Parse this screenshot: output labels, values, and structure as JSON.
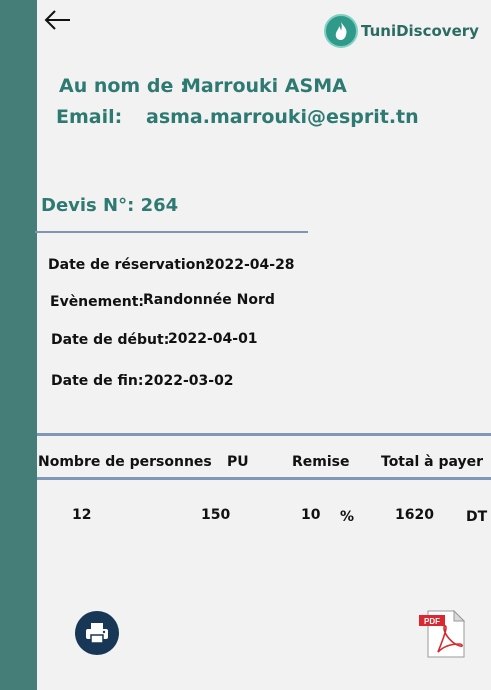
{
  "brand": {
    "name": "TuniDiscovery"
  },
  "client": {
    "name_label": "Au nom de :",
    "name": "Marrouki ASMA",
    "email_label": "Email:",
    "email": "asma.marrouki@esprit.tn"
  },
  "devis": {
    "label": "Devis N°:",
    "number": "264"
  },
  "details": {
    "reservation_label": "Date de réservation:",
    "reservation_date": "2022-04-28",
    "event_label": "Evènement:",
    "event": "Randonnée Nord",
    "start_label": "Date de début:",
    "start_date": "2022-04-01",
    "end_label": "Date de fin:",
    "end_date": "2022-03-02"
  },
  "table": {
    "headers": [
      "Nombre de personnes",
      "PU",
      "Remise",
      "Total à payer"
    ],
    "row": {
      "persons": "12",
      "unit_price": "150",
      "discount": "10",
      "discount_unit": "%",
      "total": "1620",
      "currency": "DT"
    }
  },
  "icons": {
    "back": "arrow-left-icon",
    "logo": "flame-logo-icon",
    "print": "printer-icon",
    "pdf": "pdf-file-icon"
  },
  "colors": {
    "sidebar": "#457e79",
    "accent": "#2e7a72",
    "divider": "#8197b8",
    "print_button": "#183656",
    "pdf_red": "#d9282f"
  }
}
